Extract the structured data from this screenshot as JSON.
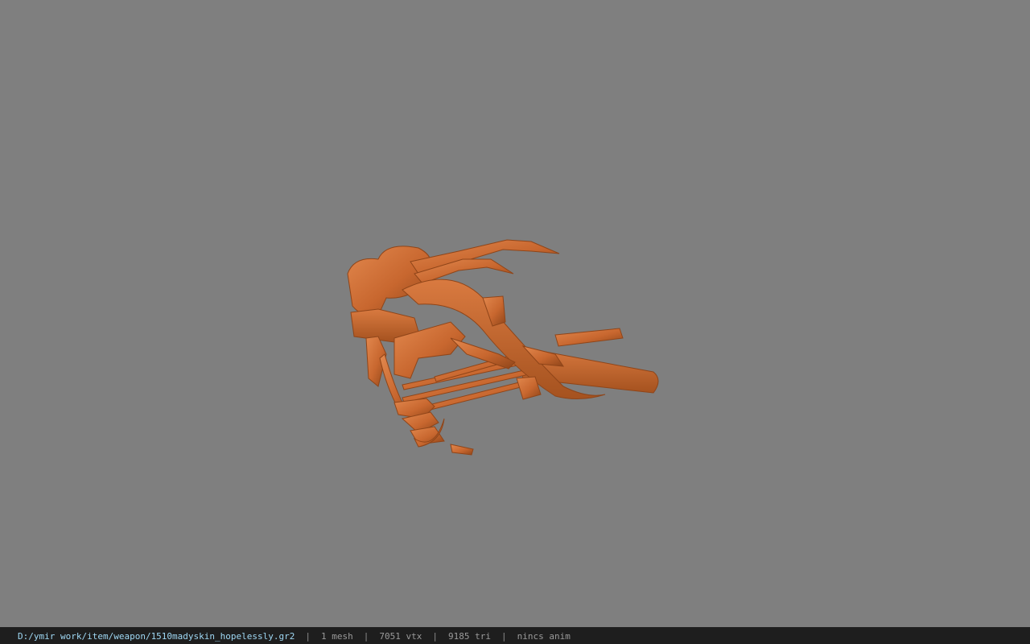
{
  "viewer": {
    "background_color": "#7f7f7f",
    "model_color": "#c8672f",
    "model_shadow_color": "#8f4519",
    "model_highlight_color": "#e2884e"
  },
  "status_bar": {
    "file_path": "D:/ymir work/item/weapon/1510madyskin_hopelessly.gr2",
    "separator": "|",
    "mesh_count": "1 mesh",
    "vertex_count": "7051 vtx",
    "triangle_count": "9185 tri",
    "animation": "nincs anim"
  }
}
